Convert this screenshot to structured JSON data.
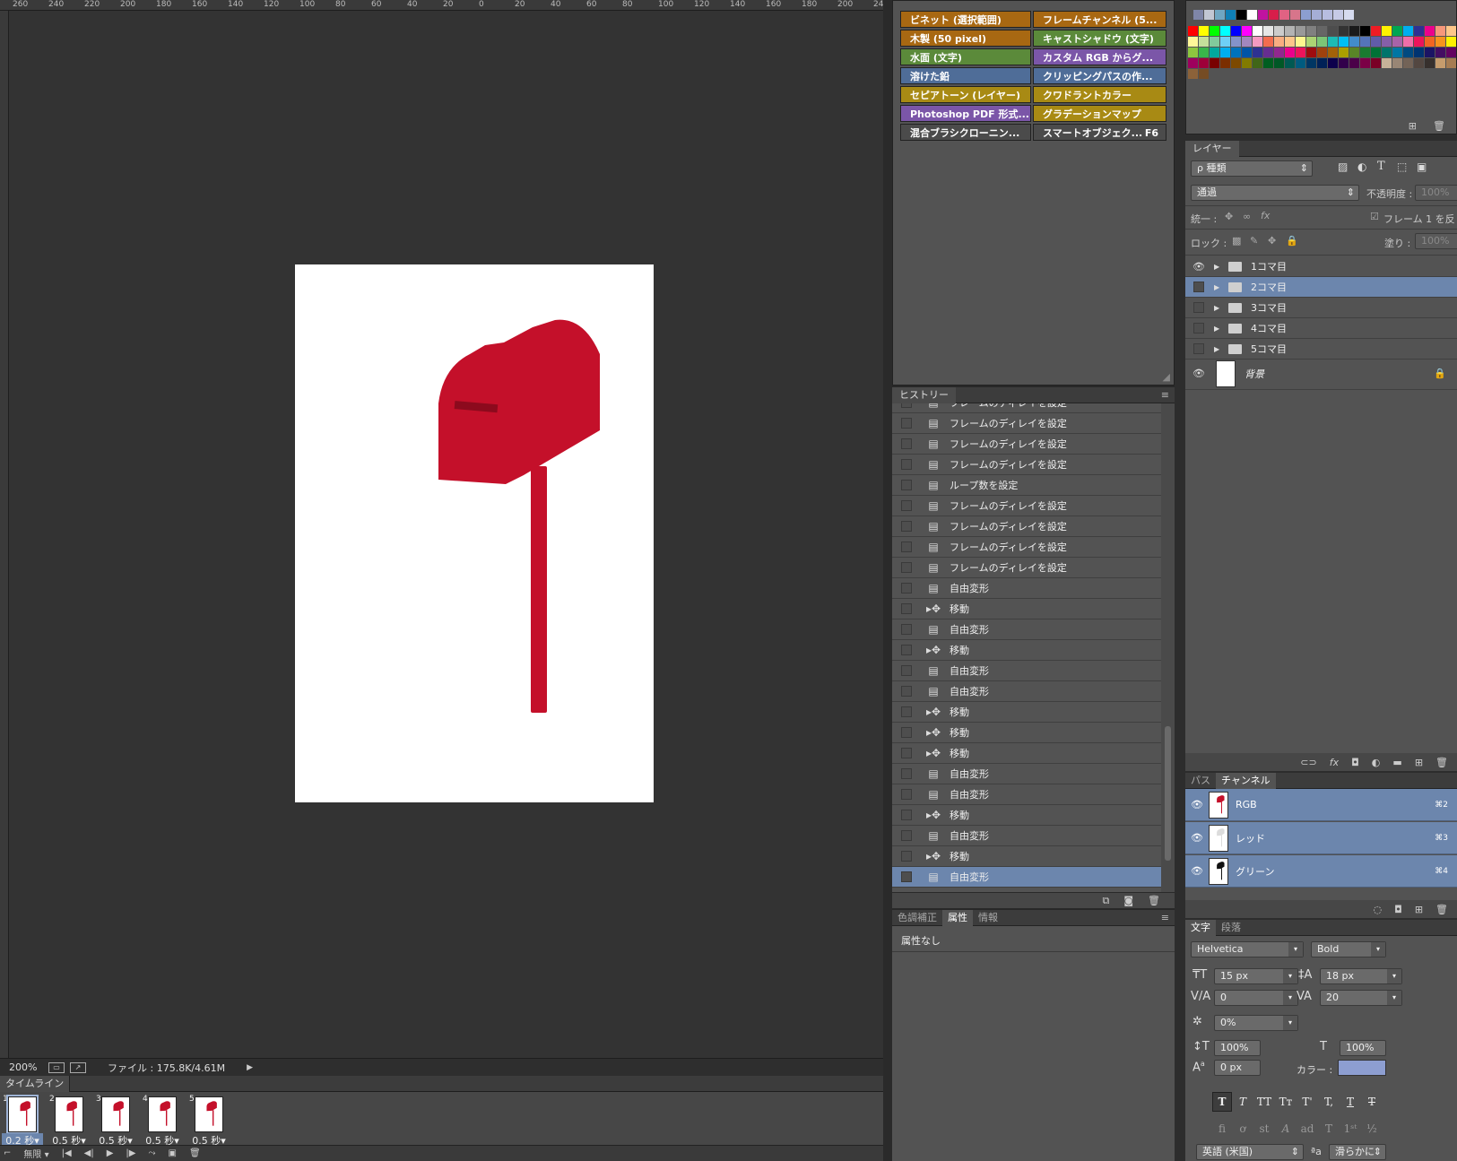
{
  "ruler": {
    "ticks": [
      "260",
      "240",
      "220",
      "200",
      "180",
      "160",
      "140",
      "120",
      "100",
      "80",
      "60",
      "40",
      "20",
      "0",
      "20",
      "40",
      "60",
      "80",
      "100",
      "120",
      "140",
      "160",
      "180",
      "200",
      "24"
    ]
  },
  "status": {
    "zoom": "200%",
    "file": "ファイル : 175.8K/4.61M"
  },
  "timeline": {
    "tab": "タイムライン",
    "frames": [
      {
        "num": "1",
        "delay": "0.2 秒▾"
      },
      {
        "num": "2",
        "delay": "0.5 秒▾"
      },
      {
        "num": "3",
        "delay": "0.5 秒▾"
      },
      {
        "num": "4",
        "delay": "0.5 秒▾"
      },
      {
        "num": "5",
        "delay": "0.5 秒▾"
      }
    ],
    "loop": "無限"
  },
  "actions": [
    {
      "label": "ビネット (選択範囲)",
      "color": "#a86812"
    },
    {
      "label": "フレームチャンネル (5...",
      "color": "#a86812"
    },
    {
      "label": "木製 (50 pixel)",
      "color": "#a86812"
    },
    {
      "label": "キャストシャドウ (文字)",
      "color": "#5b8a3a"
    },
    {
      "label": "水面 (文字)",
      "color": "#5b8a3a"
    },
    {
      "label": "カスタム RGB からグ...",
      "color": "#7b56a8"
    },
    {
      "label": "溶けた鉛",
      "color": "#4f6d98"
    },
    {
      "label": "クリッピングパスの作...",
      "color": "#4f6d98"
    },
    {
      "label": "セピアトーン (レイヤー)",
      "color": "#a88a14"
    },
    {
      "label": "クワドラントカラー",
      "color": "#a88a14"
    },
    {
      "label": "Photoshop PDF 形式...",
      "color": "#7b56a8"
    },
    {
      "label": "グラデーションマップ",
      "color": "#a88a14"
    },
    {
      "label": "混合ブラシクローニン...",
      "color": "#4b4b4b"
    },
    {
      "label": "スマートオブジェク...",
      "color": "#4b4b4b",
      "key": "F6"
    }
  ],
  "history": {
    "tab": "ヒストリー",
    "items": [
      {
        "label": "フレームのディレイを設定",
        "icon": "doc"
      },
      {
        "label": "フレームのディレイを設定",
        "icon": "doc"
      },
      {
        "label": "フレームのディレイを設定",
        "icon": "doc"
      },
      {
        "label": "フレームのディレイを設定",
        "icon": "doc"
      },
      {
        "label": "ループ数を設定",
        "icon": "doc"
      },
      {
        "label": "フレームのディレイを設定",
        "icon": "doc"
      },
      {
        "label": "フレームのディレイを設定",
        "icon": "doc"
      },
      {
        "label": "フレームのディレイを設定",
        "icon": "doc"
      },
      {
        "label": "フレームのディレイを設定",
        "icon": "doc"
      },
      {
        "label": "自由変形",
        "icon": "doc"
      },
      {
        "label": "移動",
        "icon": "move"
      },
      {
        "label": "自由変形",
        "icon": "doc"
      },
      {
        "label": "移動",
        "icon": "move"
      },
      {
        "label": "自由変形",
        "icon": "doc"
      },
      {
        "label": "自由変形",
        "icon": "doc"
      },
      {
        "label": "移動",
        "icon": "move"
      },
      {
        "label": "移動",
        "icon": "move"
      },
      {
        "label": "移動",
        "icon": "move"
      },
      {
        "label": "自由変形",
        "icon": "doc"
      },
      {
        "label": "自由変形",
        "icon": "doc"
      },
      {
        "label": "移動",
        "icon": "move"
      },
      {
        "label": "自由変形",
        "icon": "doc"
      },
      {
        "label": "移動",
        "icon": "move"
      },
      {
        "label": "自由変形",
        "icon": "doc",
        "selected": true
      }
    ]
  },
  "properties": {
    "tabs": [
      "色調補正",
      "属性",
      "情報"
    ],
    "active": "属性",
    "empty": "属性なし"
  },
  "layers": {
    "tab": "レイヤー",
    "filter": "ρ 種類",
    "blend": "通過",
    "opacity_label": "不透明度 :",
    "opacity": "100%",
    "unify_label": "統一 :",
    "propagate": "フレーム 1 を反",
    "lock_label": "ロック :",
    "fill_label": "塗り :",
    "fill": "100%",
    "items": [
      {
        "name": "1コマ目",
        "visible": true
      },
      {
        "name": "2コマ目",
        "visible": false,
        "selected": true
      },
      {
        "name": "3コマ目",
        "visible": false
      },
      {
        "name": "4コマ目",
        "visible": false
      },
      {
        "name": "5コマ目",
        "visible": false
      }
    ],
    "background": "背景"
  },
  "channels": {
    "tabs": [
      "パス",
      "チャンネル"
    ],
    "items": [
      {
        "name": "RGB",
        "key": "⌘2"
      },
      {
        "name": "レッド",
        "key": "⌘3"
      },
      {
        "name": "グリーン",
        "key": "⌘4"
      }
    ]
  },
  "character": {
    "tabs": [
      "文字",
      "段落"
    ],
    "font": "Helvetica",
    "style": "Bold",
    "size": "15 px",
    "leading": "18 px",
    "kerning": "0",
    "tracking": "20",
    "tsume": "0%",
    "vscale": "100%",
    "hscale": "100%",
    "baseline": "0 px",
    "color_label": "カラー :",
    "color": "#8d9ed1",
    "language": "英語 (米国)",
    "aa": "滑らかに"
  },
  "colors": {
    "mailbox": "#c4102a",
    "selection": "#6c86ad"
  }
}
